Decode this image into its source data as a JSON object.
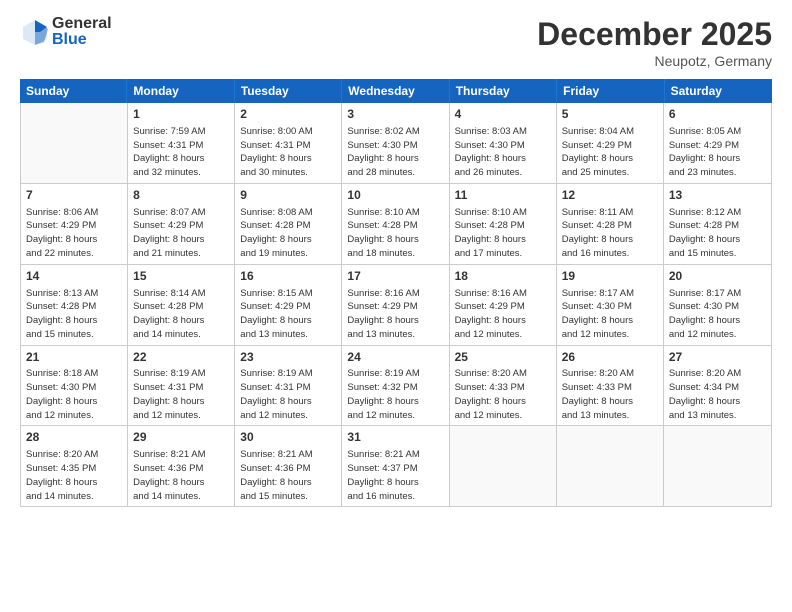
{
  "logo": {
    "general": "General",
    "blue": "Blue"
  },
  "title": "December 2025",
  "location": "Neupotz, Germany",
  "headers": [
    "Sunday",
    "Monday",
    "Tuesday",
    "Wednesday",
    "Thursday",
    "Friday",
    "Saturday"
  ],
  "weeks": [
    [
      {
        "day": "",
        "info": ""
      },
      {
        "day": "1",
        "info": "Sunrise: 7:59 AM\nSunset: 4:31 PM\nDaylight: 8 hours\nand 32 minutes."
      },
      {
        "day": "2",
        "info": "Sunrise: 8:00 AM\nSunset: 4:31 PM\nDaylight: 8 hours\nand 30 minutes."
      },
      {
        "day": "3",
        "info": "Sunrise: 8:02 AM\nSunset: 4:30 PM\nDaylight: 8 hours\nand 28 minutes."
      },
      {
        "day": "4",
        "info": "Sunrise: 8:03 AM\nSunset: 4:30 PM\nDaylight: 8 hours\nand 26 minutes."
      },
      {
        "day": "5",
        "info": "Sunrise: 8:04 AM\nSunset: 4:29 PM\nDaylight: 8 hours\nand 25 minutes."
      },
      {
        "day": "6",
        "info": "Sunrise: 8:05 AM\nSunset: 4:29 PM\nDaylight: 8 hours\nand 23 minutes."
      }
    ],
    [
      {
        "day": "7",
        "info": "Sunrise: 8:06 AM\nSunset: 4:29 PM\nDaylight: 8 hours\nand 22 minutes."
      },
      {
        "day": "8",
        "info": "Sunrise: 8:07 AM\nSunset: 4:29 PM\nDaylight: 8 hours\nand 21 minutes."
      },
      {
        "day": "9",
        "info": "Sunrise: 8:08 AM\nSunset: 4:28 PM\nDaylight: 8 hours\nand 19 minutes."
      },
      {
        "day": "10",
        "info": "Sunrise: 8:10 AM\nSunset: 4:28 PM\nDaylight: 8 hours\nand 18 minutes."
      },
      {
        "day": "11",
        "info": "Sunrise: 8:10 AM\nSunset: 4:28 PM\nDaylight: 8 hours\nand 17 minutes."
      },
      {
        "day": "12",
        "info": "Sunrise: 8:11 AM\nSunset: 4:28 PM\nDaylight: 8 hours\nand 16 minutes."
      },
      {
        "day": "13",
        "info": "Sunrise: 8:12 AM\nSunset: 4:28 PM\nDaylight: 8 hours\nand 15 minutes."
      }
    ],
    [
      {
        "day": "14",
        "info": "Sunrise: 8:13 AM\nSunset: 4:28 PM\nDaylight: 8 hours\nand 15 minutes."
      },
      {
        "day": "15",
        "info": "Sunrise: 8:14 AM\nSunset: 4:28 PM\nDaylight: 8 hours\nand 14 minutes."
      },
      {
        "day": "16",
        "info": "Sunrise: 8:15 AM\nSunset: 4:29 PM\nDaylight: 8 hours\nand 13 minutes."
      },
      {
        "day": "17",
        "info": "Sunrise: 8:16 AM\nSunset: 4:29 PM\nDaylight: 8 hours\nand 13 minutes."
      },
      {
        "day": "18",
        "info": "Sunrise: 8:16 AM\nSunset: 4:29 PM\nDaylight: 8 hours\nand 12 minutes."
      },
      {
        "day": "19",
        "info": "Sunrise: 8:17 AM\nSunset: 4:30 PM\nDaylight: 8 hours\nand 12 minutes."
      },
      {
        "day": "20",
        "info": "Sunrise: 8:17 AM\nSunset: 4:30 PM\nDaylight: 8 hours\nand 12 minutes."
      }
    ],
    [
      {
        "day": "21",
        "info": "Sunrise: 8:18 AM\nSunset: 4:30 PM\nDaylight: 8 hours\nand 12 minutes."
      },
      {
        "day": "22",
        "info": "Sunrise: 8:19 AM\nSunset: 4:31 PM\nDaylight: 8 hours\nand 12 minutes."
      },
      {
        "day": "23",
        "info": "Sunrise: 8:19 AM\nSunset: 4:31 PM\nDaylight: 8 hours\nand 12 minutes."
      },
      {
        "day": "24",
        "info": "Sunrise: 8:19 AM\nSunset: 4:32 PM\nDaylight: 8 hours\nand 12 minutes."
      },
      {
        "day": "25",
        "info": "Sunrise: 8:20 AM\nSunset: 4:33 PM\nDaylight: 8 hours\nand 12 minutes."
      },
      {
        "day": "26",
        "info": "Sunrise: 8:20 AM\nSunset: 4:33 PM\nDaylight: 8 hours\nand 13 minutes."
      },
      {
        "day": "27",
        "info": "Sunrise: 8:20 AM\nSunset: 4:34 PM\nDaylight: 8 hours\nand 13 minutes."
      }
    ],
    [
      {
        "day": "28",
        "info": "Sunrise: 8:20 AM\nSunset: 4:35 PM\nDaylight: 8 hours\nand 14 minutes."
      },
      {
        "day": "29",
        "info": "Sunrise: 8:21 AM\nSunset: 4:36 PM\nDaylight: 8 hours\nand 14 minutes."
      },
      {
        "day": "30",
        "info": "Sunrise: 8:21 AM\nSunset: 4:36 PM\nDaylight: 8 hours\nand 15 minutes."
      },
      {
        "day": "31",
        "info": "Sunrise: 8:21 AM\nSunset: 4:37 PM\nDaylight: 8 hours\nand 16 minutes."
      },
      {
        "day": "",
        "info": ""
      },
      {
        "day": "",
        "info": ""
      },
      {
        "day": "",
        "info": ""
      }
    ]
  ]
}
